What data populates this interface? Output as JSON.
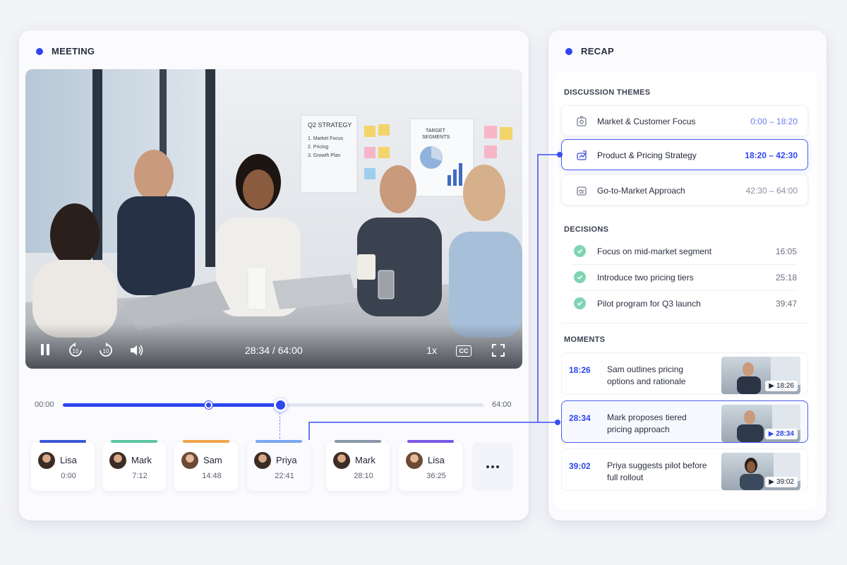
{
  "meeting": {
    "header": "MEETING",
    "player": {
      "current_time": "28:34",
      "duration": "64:00",
      "time_readout": "28:34 / 64:00",
      "speed": "1x",
      "cc_label": "CC",
      "skip_back": "10",
      "skip_forward": "10",
      "progress_fraction": 0.446
    },
    "whiteboard": {
      "title": "Q2 STRATEGY",
      "items": [
        "1. Market Focus",
        "2. Pricing",
        "3. Growth Plan"
      ]
    },
    "poster": {
      "title_line1": "TARGET",
      "title_line2": "SEGMENTS"
    },
    "timeline": {
      "start_label": "00:00",
      "end_label": "64:00",
      "marker_fraction": 0.346,
      "played_fraction": 0.516
    },
    "speakers": [
      {
        "name": "Lisa",
        "time": "0:00",
        "color": "#3c57d6"
      },
      {
        "name": "Mark",
        "time": "7:12",
        "color": "#5cc6a2"
      },
      {
        "name": "Sam",
        "time": "14:48",
        "color": "#f0a64a"
      },
      {
        "name": "Priya",
        "time": "22:41",
        "color": "#7aa6f0"
      },
      {
        "name": "Mark",
        "time": "28:10",
        "color": "#8a95a8"
      },
      {
        "name": "Lisa",
        "time": "36:25",
        "color": "#7a57e6"
      }
    ]
  },
  "recap": {
    "header": "RECAP",
    "themes_title": "DISCUSSION THEMES",
    "themes": [
      {
        "label": "Market & Customer Focus",
        "range": "0:00 – 18:20",
        "icon": "target-icon"
      },
      {
        "label": "Product & Pricing Strategy",
        "range": "18:20 – 42:30",
        "icon": "pricing-icon"
      },
      {
        "label": "Go-to-Market Approach",
        "range": "42:30 – 64:00",
        "icon": "handshake-icon"
      }
    ],
    "decisions_title": "DECISIONS",
    "decisions": [
      {
        "label": "Focus on mid-market segment",
        "time": "16:05"
      },
      {
        "label": "Introduce two pricing tiers",
        "time": "25:18"
      },
      {
        "label": "Pilot program for Q3 launch",
        "time": "39:47"
      }
    ],
    "moments_title": "MOMENTS",
    "moments": [
      {
        "time": "18:26",
        "text": "Sam outlines pricing options and rationale",
        "badge": "18:26"
      },
      {
        "time": "28:34",
        "text": "Mark proposes tiered pricing approach",
        "badge": "28:34"
      },
      {
        "time": "39:02",
        "text": "Priya suggests pilot before full rollout",
        "badge": "39:02"
      }
    ]
  },
  "colors": {
    "accent": "#2f47f0",
    "check": "#7fd4b4",
    "background": "#f3f4f8"
  }
}
